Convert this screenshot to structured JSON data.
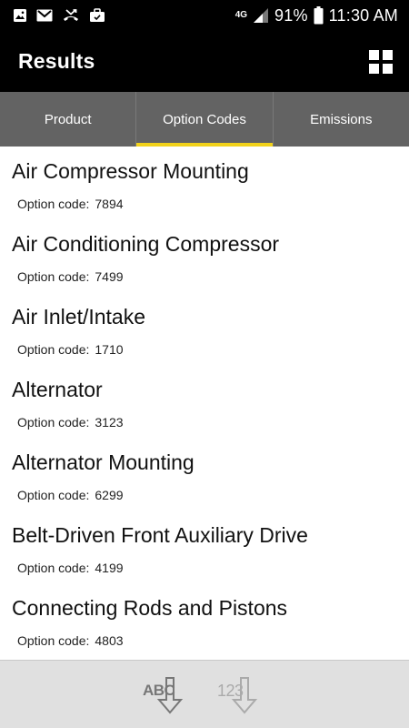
{
  "status_bar": {
    "network_label": "4G",
    "battery_pct": "91%",
    "time": "11:30 AM",
    "icons": [
      "gallery-icon",
      "gmail-icon",
      "missed-call-icon",
      "briefcase-icon",
      "network-4g-icon",
      "signal-icon",
      "battery-icon"
    ]
  },
  "app_bar": {
    "title": "Results",
    "grid_icon": "grid-view-icon"
  },
  "tabs": [
    {
      "label": "Product",
      "active": false
    },
    {
      "label": "Option Codes",
      "active": true
    },
    {
      "label": "Emissions",
      "active": false
    }
  ],
  "list": {
    "code_label": "Option code:",
    "items": [
      {
        "title": "Air Compressor Mounting",
        "code": "7894"
      },
      {
        "title": "Air Conditioning Compressor",
        "code": "7499"
      },
      {
        "title": "Air Inlet/Intake",
        "code": "1710"
      },
      {
        "title": "Alternator",
        "code": "3123"
      },
      {
        "title": "Alternator Mounting",
        "code": "6299"
      },
      {
        "title": "Belt-Driven Front Auxiliary Drive",
        "code": "4199"
      },
      {
        "title": "Connecting Rods and Pistons",
        "code": "4803"
      }
    ]
  },
  "bottom_bar": {
    "sort_alpha_label": "ABC",
    "sort_numeric_label": "123"
  },
  "colors": {
    "bar_background": "#000000",
    "tab_background": "#636363",
    "tab_indicator": "#f2d21a",
    "bottom_bar_background": "#e0e0e0"
  }
}
